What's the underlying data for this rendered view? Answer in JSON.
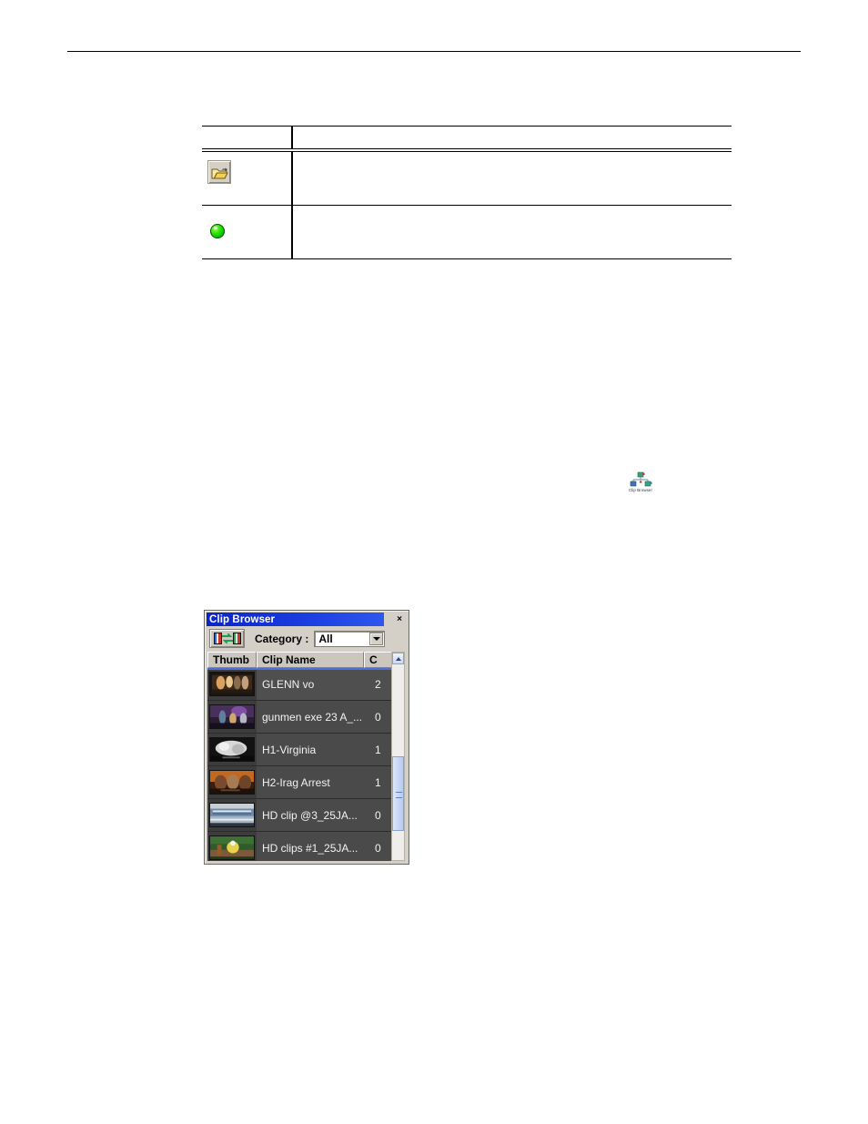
{
  "page": {
    "header_rule": true
  },
  "doc_table": {
    "columns": [
      "",
      ""
    ],
    "rows": [
      {
        "icon": "open-folder-icon",
        "description": ""
      },
      {
        "icon": "green-status-led-icon",
        "description": ""
      }
    ]
  },
  "shortcut": {
    "icon": "clip-browser-shortcut-icon",
    "label": "Clip Browser"
  },
  "clip_browser": {
    "title": "Clip Browser",
    "close_label": "×",
    "toolbar": {
      "view_toggle_icon": "color-bars-swap-icon",
      "category_label": "Category :",
      "category_value": "All",
      "category_options": [
        "All"
      ]
    },
    "columns": [
      "Thumb",
      "Clip Name",
      "C"
    ],
    "rows": [
      {
        "thumb": "thumb-group-indoor",
        "name": "GLENN vo",
        "third": "2"
      },
      {
        "thumb": "thumb-stage-purple",
        "name": "gunmen exe 23 A_...",
        "third": "0"
      },
      {
        "thumb": "thumb-crowd-bw",
        "name": "H1-Virginia",
        "third": "1"
      },
      {
        "thumb": "thumb-arrest-orange",
        "name": "H2-Irag Arrest",
        "third": "1"
      },
      {
        "thumb": "thumb-stadium-blue",
        "name": "HD clip @3_25JA...",
        "third": "0"
      },
      {
        "thumb": "thumb-field-green",
        "name": "HD clips #1_25JA...",
        "third": "0"
      }
    ],
    "selected_row_index": 0,
    "scrollbar": {
      "up_arrow": "chevron-up-icon",
      "thumb_grip": "scroll-grip-icon"
    }
  },
  "colors": {
    "titlebar_blue": "#0a24c8",
    "window_face": "#d4d0c8",
    "list_background": "#3c3c3c",
    "row_background": "#4a4a4a",
    "led_green": "#2ee000",
    "scroll_accent": "#b7caf0"
  }
}
